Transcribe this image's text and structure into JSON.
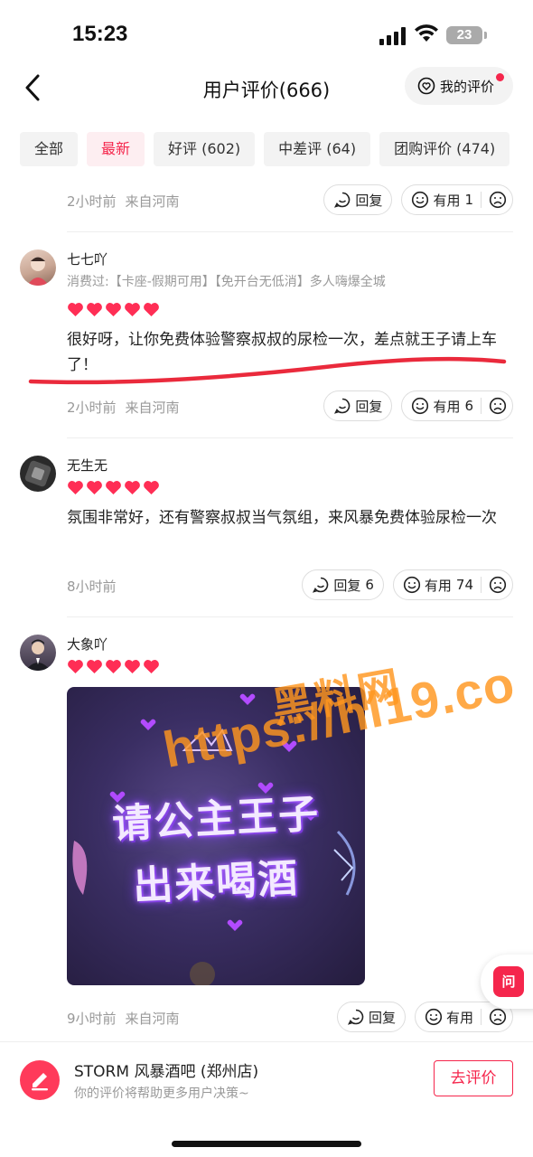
{
  "status_bar": {
    "time": "15:23",
    "battery": "23"
  },
  "nav": {
    "title": "用户评价(666)",
    "my_review_label": "我的评价"
  },
  "tabs": [
    {
      "label": "全部",
      "active": false
    },
    {
      "label": "最新",
      "active": true
    },
    {
      "label": "好评 (602)",
      "active": false
    },
    {
      "label": "中差评 (64)",
      "active": false
    },
    {
      "label": "团购评价 (474)",
      "active": false
    }
  ],
  "reviews": [
    {
      "time": "2小时前",
      "location": "来自河南",
      "reply_label": "回复",
      "reply_count": "",
      "useful_label": "有用",
      "useful_count": "1"
    },
    {
      "username": "七七吖",
      "consumed": "消费过:【卡座-假期可用】【免开台无低消】多人嗨爆全城",
      "text": "很好呀，让你免费体验警察叔叔的尿检一次，差点就王子请上车了！",
      "time": "2小时前",
      "location": "来自河南",
      "reply_label": "回复",
      "reply_count": "",
      "useful_label": "有用",
      "useful_count": "6"
    },
    {
      "username": "无生无",
      "text": "氛围非常好，还有警察叔叔当气氛组，来风暴免费体验尿检一次",
      "time": "8小时前",
      "location": "",
      "reply_label": "回复",
      "reply_count": "6",
      "useful_label": "有用",
      "useful_count": "74"
    },
    {
      "username": "大象吖",
      "photo_text_line1": "请公主王子",
      "photo_text_line2": "出来喝酒",
      "time": "9小时前",
      "location": "来自河南",
      "reply_label": "回复",
      "reply_count": "",
      "useful_label": "有用",
      "useful_count": ""
    }
  ],
  "watermark": {
    "line1": "黑料网",
    "line2": "https://hl19.co"
  },
  "float_button": {
    "label": "问"
  },
  "bottom": {
    "store_name": "STORM 风暴酒吧 (郑州店)",
    "store_sub": "你的评价将帮助更多用户决策~",
    "rate_label": "去评价"
  },
  "colors": {
    "accent": "#f5264c",
    "heart": "#ff2e55",
    "underline": "#ea2a3c"
  }
}
